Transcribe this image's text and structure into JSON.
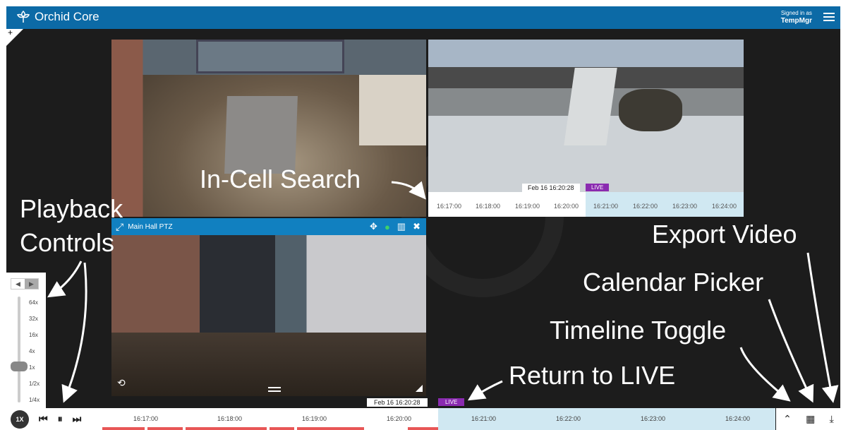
{
  "app": {
    "title": "Orchid Core",
    "logo_icon": "orchid-logo-icon"
  },
  "user": {
    "signed_in_label": "Signed in as",
    "username": "TempMgr"
  },
  "cells": {
    "top_right_timeline": {
      "timestamp": "Feb 16 16:20:28",
      "live_label": "LIVE",
      "ticks": [
        "16:17:00",
        "16:18:00",
        "16:19:00",
        "16:20:00",
        "16:21:00",
        "16:22:00",
        "16:23:00",
        "16:24:00"
      ]
    },
    "ptz_cell": {
      "title": "Main Hall PTZ"
    }
  },
  "speed_levels": [
    "64x",
    "32x",
    "16x",
    "4x",
    "1x",
    "1/2x",
    "1/4x"
  ],
  "playback": {
    "speed_button": "1X"
  },
  "main_timeline": {
    "timestamp": "Feb 16 16:20:28",
    "live_label": "LIVE",
    "ticks": [
      "16:17:00",
      "16:18:00",
      "16:19:00",
      "16:20:00",
      "16:21:00",
      "16:22:00",
      "16:23:00",
      "16:24:00"
    ]
  },
  "annotations": {
    "in_cell_search": "In-Cell Search",
    "playback_line1": "Playback",
    "playback_line2": "Controls",
    "export_video": "Export Video",
    "calendar_picker": "Calendar Picker",
    "timeline_toggle": "Timeline Toggle",
    "return_to_live": "Return to LIVE"
  },
  "colors": {
    "topbar": "#0c6aa6",
    "live": "#8a2bb0",
    "recording": "#e85656",
    "live_zone": "#d0e8f2"
  }
}
